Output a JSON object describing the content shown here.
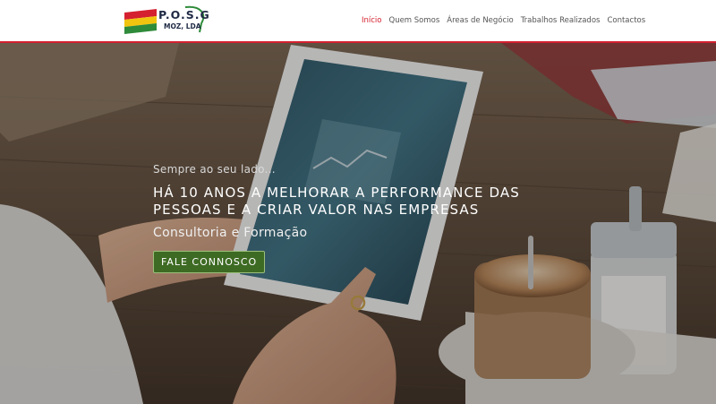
{
  "brand": {
    "name": "P.O.S.G",
    "subtitle": "MOZ, LDA",
    "colors": {
      "accent": "#d4202f",
      "green": "#3e6b24",
      "yellow": "#f1c40f",
      "dark": "#1f2a44"
    }
  },
  "nav": {
    "items": [
      {
        "label": "Início",
        "active": true
      },
      {
        "label": "Quem Somos",
        "active": false
      },
      {
        "label": "Áreas de Negócio",
        "active": false
      },
      {
        "label": "Trabalhos Realizados",
        "active": false
      },
      {
        "label": "Contactos",
        "active": false
      }
    ]
  },
  "hero": {
    "tagline": "Sempre ao seu lado...",
    "headline_line1": "HÁ 10 ANOS A MELHORAR A PERFORMANCE DAS",
    "headline_line2": "PESSOAS E A CRIAR VALOR NAS EMPRESAS",
    "subheadline": "Consultoria e Formação",
    "cta_label": "FALE CONNOSCO"
  }
}
